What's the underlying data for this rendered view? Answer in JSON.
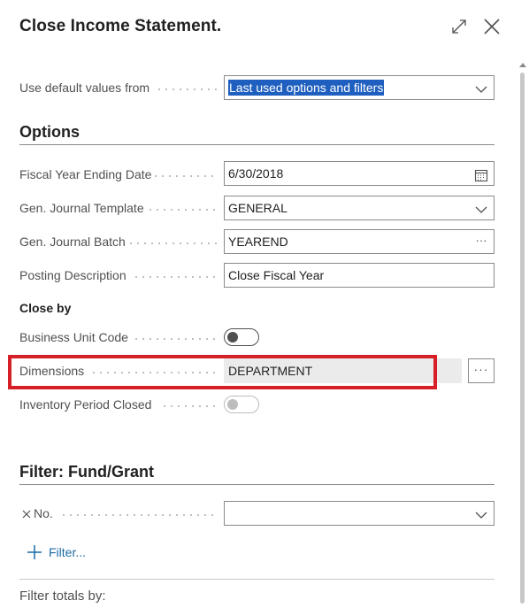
{
  "dialog": {
    "title": "Close Income Statement.",
    "defaults_label": "Use default values from",
    "defaults_value": "Last used options and filters"
  },
  "options": {
    "heading": "Options",
    "fiscal_year_label": "Fiscal Year Ending Date",
    "fiscal_year_value": "6/30/2018",
    "template_label": "Gen. Journal Template",
    "template_value": "GENERAL",
    "batch_label": "Gen. Journal Batch",
    "batch_value": "YEAREND",
    "posting_label": "Posting Description",
    "posting_value": "Close Fiscal Year",
    "close_by_heading": "Close by",
    "business_unit_label": "Business Unit Code",
    "business_unit_on": false,
    "dimensions_label": "Dimensions",
    "dimensions_value": "DEPARTMENT",
    "dimensions_button": "···",
    "inventory_label": "Inventory Period Closed",
    "inventory_on": false
  },
  "filter": {
    "heading": "Filter: Fund/Grant",
    "no_label": "No.",
    "no_value": "",
    "add_filter_label": "Filter..."
  },
  "footer": {
    "filter_totals_label": "Filter totals by:"
  },
  "colors": {
    "highlight": "#d61f26",
    "link": "#1a6aa6",
    "selection": "#1f5fbf"
  },
  "icons": [
    "expand-icon",
    "close-icon",
    "chevron-down-icon",
    "calendar-icon",
    "ellipsis-icon",
    "remove-filter-icon",
    "plus-icon"
  ]
}
